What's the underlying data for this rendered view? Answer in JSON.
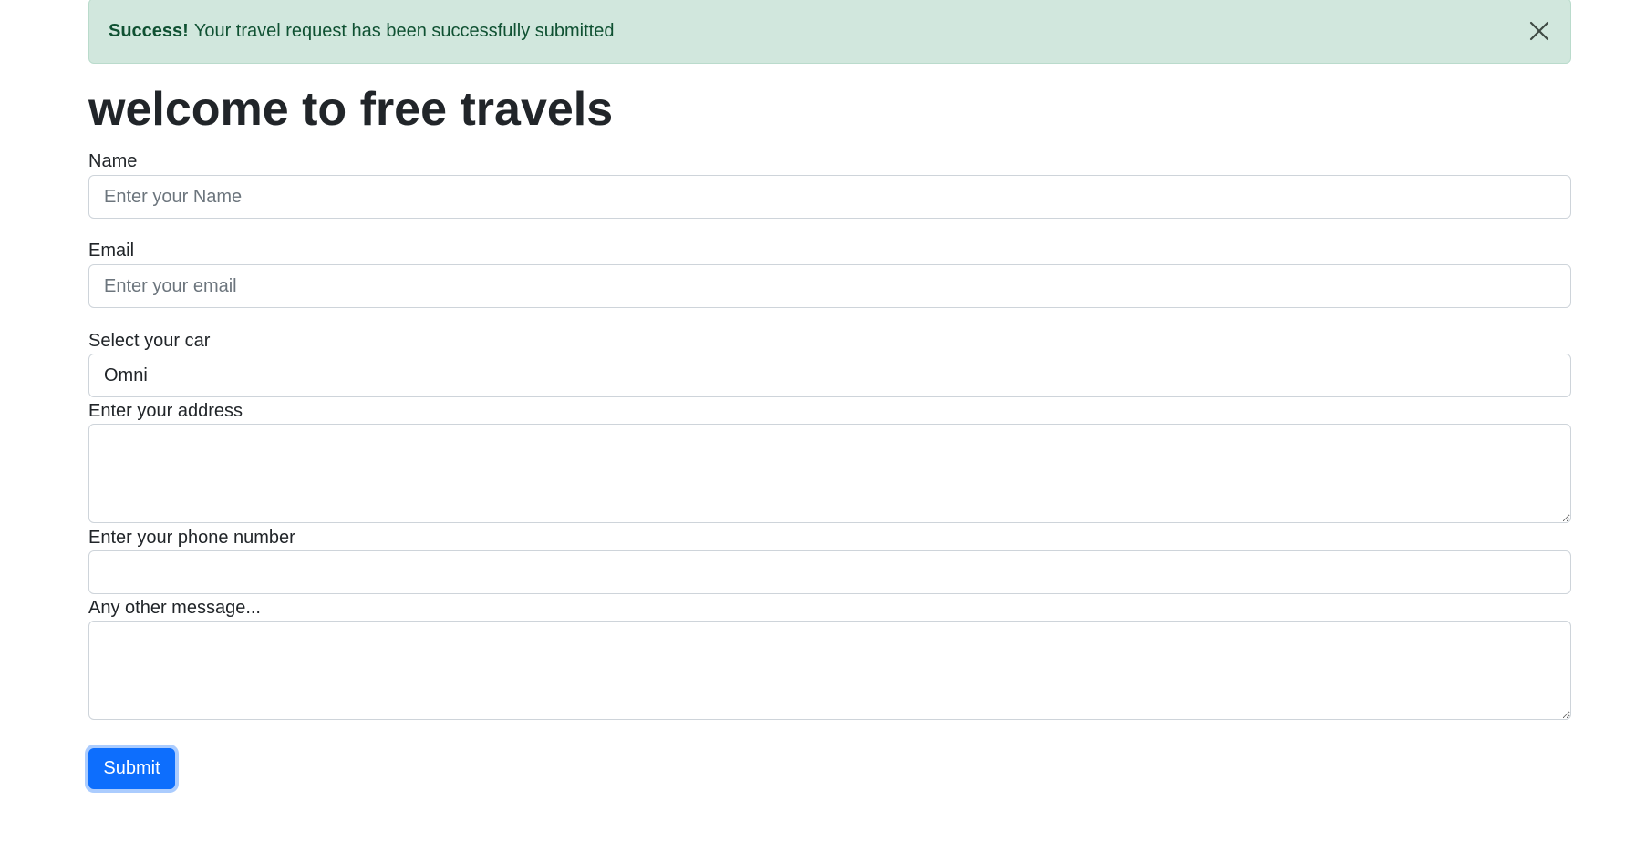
{
  "alert": {
    "strong": "Success!",
    "message": "Your travel request has been successfully submitted",
    "close_icon": "close-icon"
  },
  "heading": "welcome to free travels",
  "form": {
    "name": {
      "label": "Name",
      "placeholder": "Enter your Name",
      "value": ""
    },
    "email": {
      "label": "Email",
      "placeholder": "Enter your email",
      "value": ""
    },
    "car": {
      "label": "Select your car",
      "selected": "Omni"
    },
    "address": {
      "label": "Enter your address",
      "value": ""
    },
    "phone": {
      "label": "Enter your phone number",
      "value": ""
    },
    "message": {
      "label": "Any other message...",
      "value": ""
    },
    "submit_label": "Submit"
  },
  "colors": {
    "alert_bg": "#d1e7dd",
    "alert_text": "#0f5132",
    "primary": "#0d6efd"
  }
}
